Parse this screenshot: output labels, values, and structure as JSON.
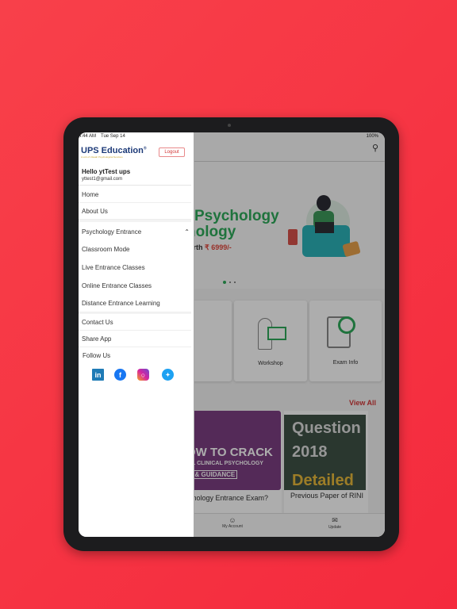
{
  "status_bar": {
    "time": "4:44 AM",
    "date": "Tue Sep 14",
    "battery": "100%"
  },
  "drawer": {
    "brand": "UPS Education",
    "brand_tagline": "A unit of Utsaah Psychological Services",
    "logout_label": "Logout",
    "greeting": "Hello ytTest ups",
    "email": "yttest1@gmail.com",
    "items": [
      {
        "label": "Home"
      },
      {
        "label": "About Us"
      },
      {
        "label": "Psychology Entrance"
      },
      {
        "label": "Classroom Mode"
      },
      {
        "label": "Live Entrance Classes"
      },
      {
        "label": "Online Entrance Classes"
      },
      {
        "label": "Distance Entrance Learning"
      },
      {
        "label": "Contact Us"
      },
      {
        "label": "Share App"
      },
      {
        "label": "Follow Us"
      }
    ],
    "social": [
      "linkedin-icon",
      "facebook-icon",
      "instagram-icon",
      "twitter-icon"
    ]
  },
  "banner": {
    "line1": "Psychology",
    "line2": "hology",
    "price_prefix": "orth",
    "price": "₹ 6999/-"
  },
  "categories": [
    {
      "label": "rses"
    },
    {
      "label": "Workshop"
    },
    {
      "label": "Exam Info"
    }
  ],
  "articles": {
    "view_all": "View All",
    "cards": [
      {
        "thumb_lines": [
          "OW TO CRACK",
          "HIL CLINICAL PSYCHOLOGY",
          "S & GUIDANCE"
        ],
        "caption": "Psychology Entrance Exam?"
      },
      {
        "thumb_lines": [
          "Question",
          "2018",
          "Detailed A"
        ],
        "caption": "Previous Paper of RINI"
      }
    ]
  },
  "tabbar": {
    "account": "My Account",
    "update": "Update"
  },
  "colors": {
    "accent": "#d23838",
    "green": "#2faa5a",
    "background": "#f5313f"
  }
}
